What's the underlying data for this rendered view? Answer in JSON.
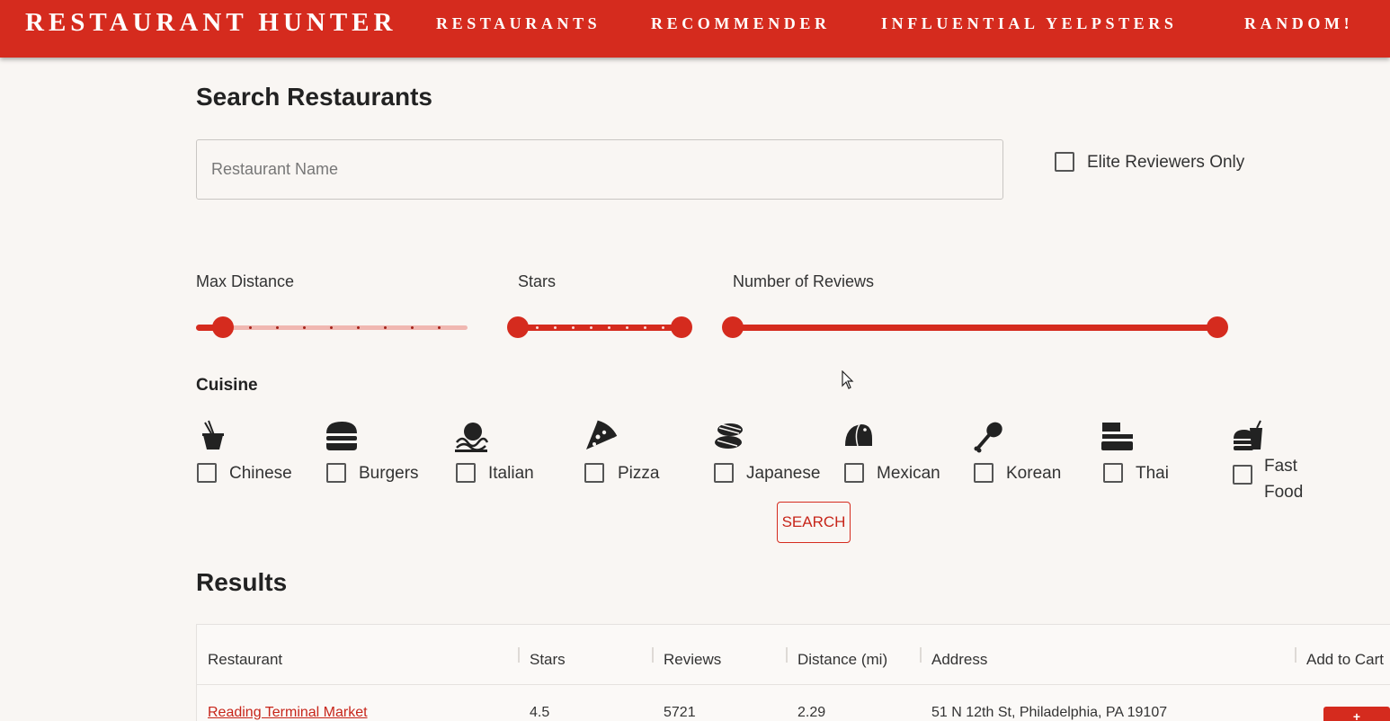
{
  "header": {
    "brand": "RESTAURANT HUNTER",
    "nav": [
      "RESTAURANTS",
      "RECOMMENDER",
      "INFLUENTIAL YELPSTERS",
      "RANDOM!"
    ]
  },
  "search": {
    "title": "Search Restaurants",
    "name_placeholder": "Restaurant Name",
    "elite_label": "Elite Reviewers Only",
    "elite_checked": false
  },
  "sliders": {
    "max_distance": {
      "label": "Max Distance",
      "value_fraction": 0.1
    },
    "stars": {
      "label": "Stars",
      "range_fraction": [
        0,
        1
      ]
    },
    "reviews": {
      "label": "Number of Reviews",
      "range_fraction": [
        0,
        1
      ]
    }
  },
  "cuisine": {
    "title": "Cuisine",
    "items": [
      {
        "label": "Chinese",
        "icon": "chinese-takeout-icon"
      },
      {
        "label": "Burgers",
        "icon": "burger-icon"
      },
      {
        "label": "Italian",
        "icon": "spaghetti-icon"
      },
      {
        "label": "Pizza",
        "icon": "pizza-slice-icon"
      },
      {
        "label": "Japanese",
        "icon": "sushi-icon"
      },
      {
        "label": "Mexican",
        "icon": "taco-icon"
      },
      {
        "label": "Korean",
        "icon": "drumstick-icon"
      },
      {
        "label": "Thai",
        "icon": "noodle-box-icon"
      },
      {
        "label": "Fast Food",
        "icon": "fast-food-icon"
      }
    ]
  },
  "search_button": "SEARCH",
  "results": {
    "title": "Results",
    "columns": [
      "Restaurant",
      "Stars",
      "Reviews",
      "Distance (mi)",
      "Address",
      "Add to Cart"
    ],
    "rows": [
      {
        "name": "Reading Terminal Market",
        "stars": "4.5",
        "reviews": "5721",
        "distance": "2.29",
        "address": "51 N 12th St, Philadelphia, PA 19107",
        "add": "+"
      }
    ]
  },
  "colors": {
    "brand": "#d52b1e",
    "background": "#f9f6f3"
  }
}
